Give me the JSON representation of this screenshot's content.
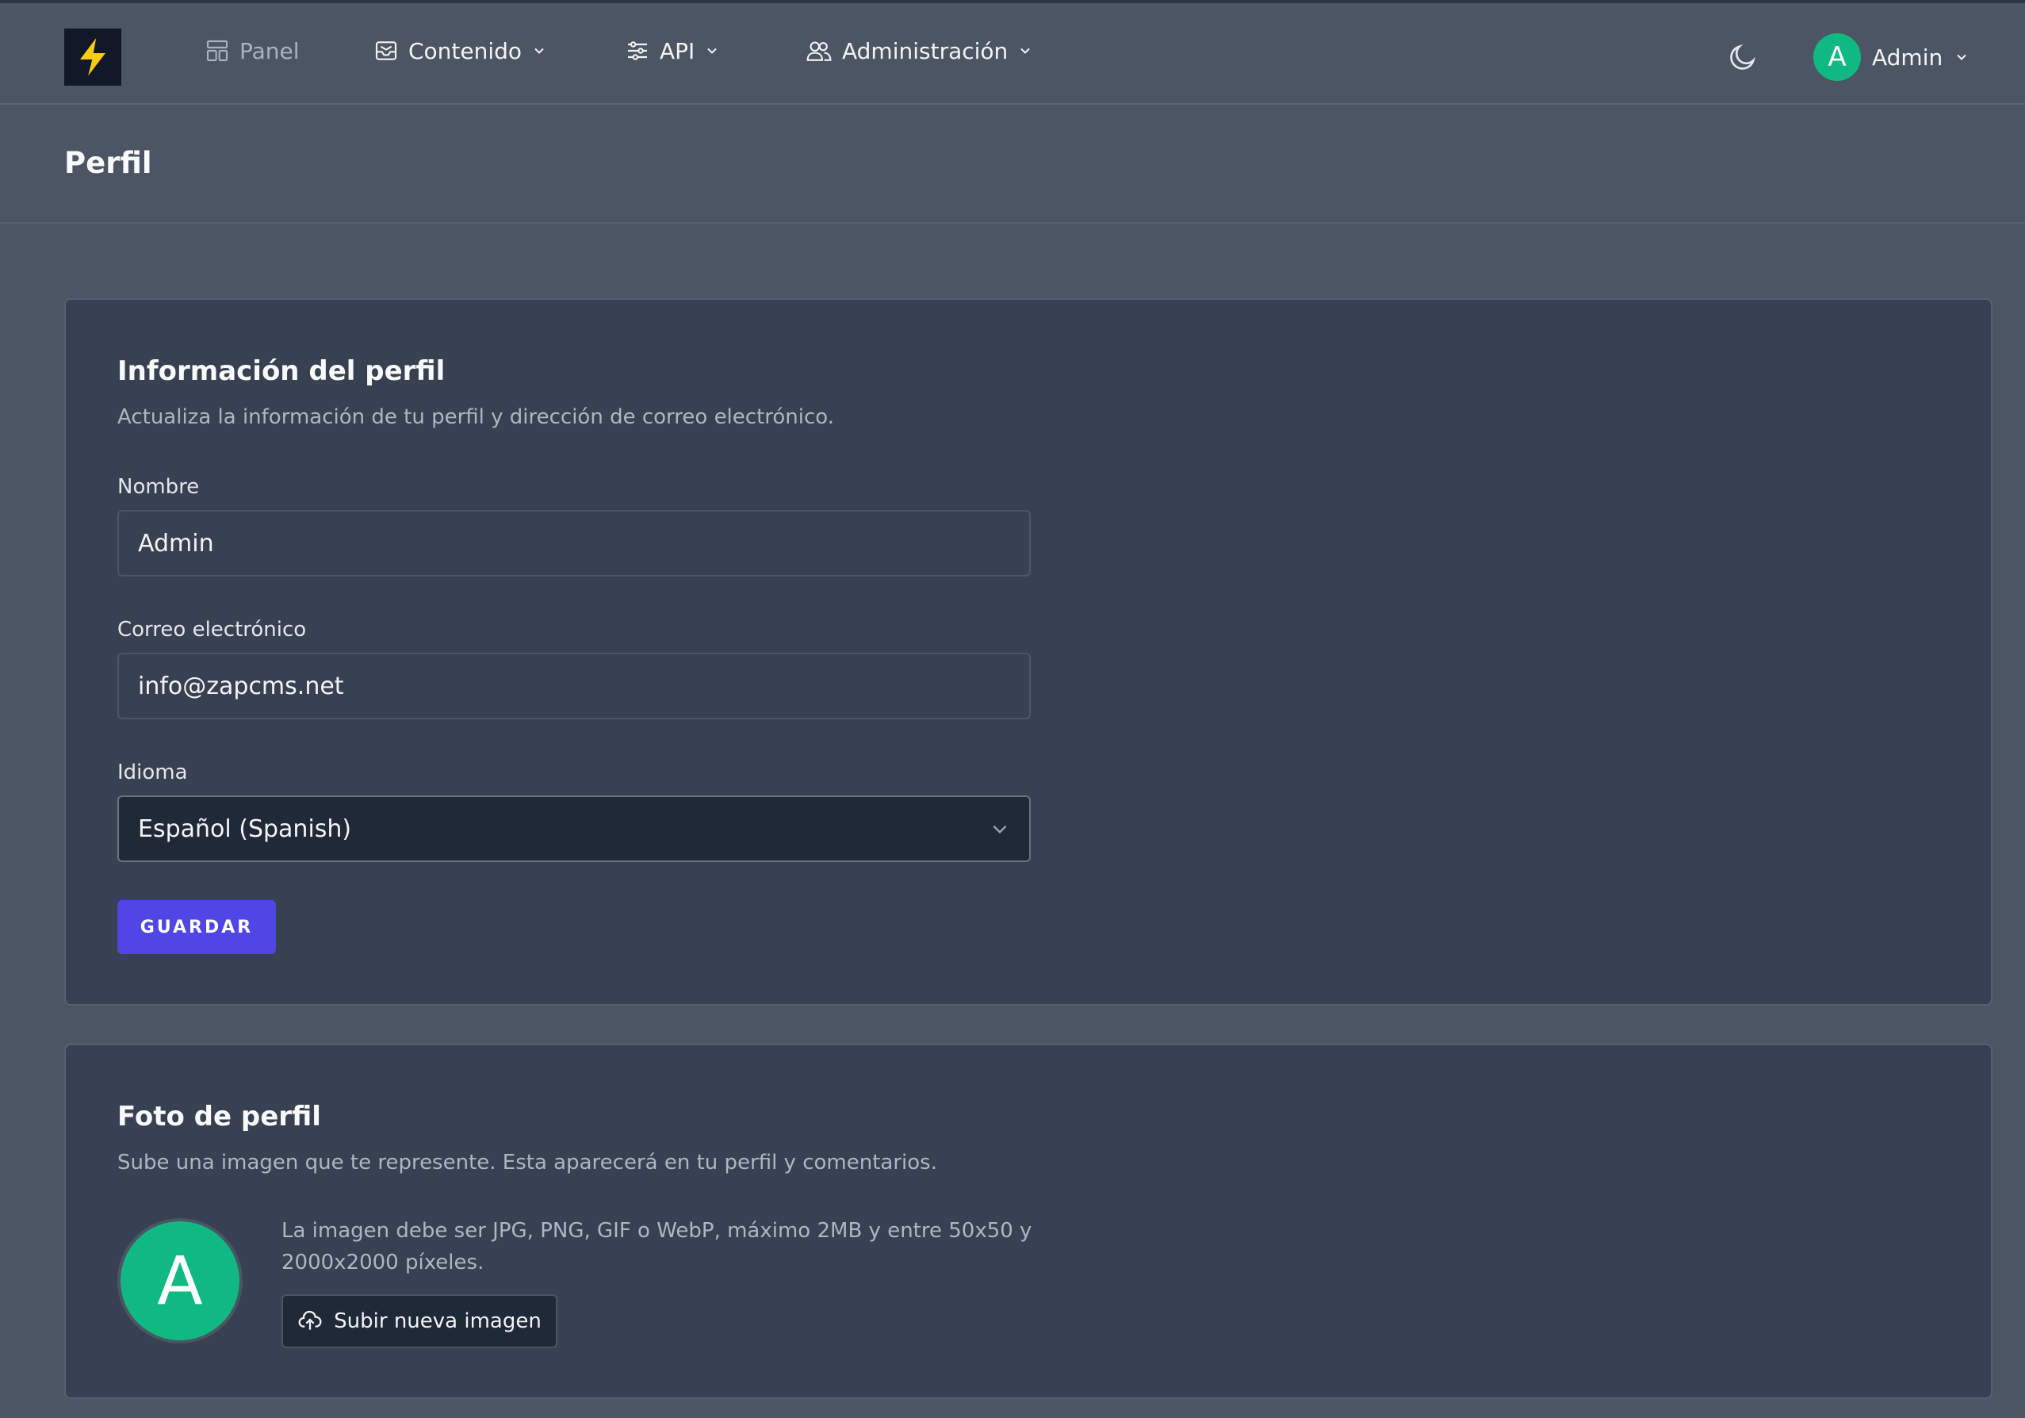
{
  "nav": {
    "logo": "lightning-bolt-logo",
    "items": [
      {
        "label": "Panel",
        "icon": "layout-icon"
      },
      {
        "label": "Contenido",
        "icon": "inbox-icon"
      },
      {
        "label": "API",
        "icon": "sliders-icon"
      },
      {
        "label": "Administración",
        "icon": "users-icon"
      }
    ],
    "theme_icon": "moon-icon",
    "user": {
      "initial": "A",
      "name": "Admin"
    }
  },
  "page": {
    "title": "Perfil"
  },
  "profile_info": {
    "title": "Información del perfil",
    "description": "Actualiza la información de tu perfil y dirección de correo electrónico.",
    "name_label": "Nombre",
    "name_value": "Admin",
    "email_label": "Correo electrónico",
    "email_value": "info@zapcms.net",
    "language_label": "Idioma",
    "language_value": "Español (Spanish)",
    "save_label": "GUARDAR"
  },
  "profile_photo": {
    "title": "Foto de perfil",
    "description": "Sube una imagen que te represente. Esta aparecerá en tu perfil y comentarios.",
    "avatar_initial": "A",
    "hint": "La imagen debe ser JPG, PNG, GIF o WebP, máximo 2MB y entre 50x50 y 2000x2000 píxeles.",
    "upload_label": "Subir nueva imagen"
  },
  "colors": {
    "accent": "#4f46e5",
    "avatar": "#10b981",
    "logo_bolt": "#facc15"
  }
}
